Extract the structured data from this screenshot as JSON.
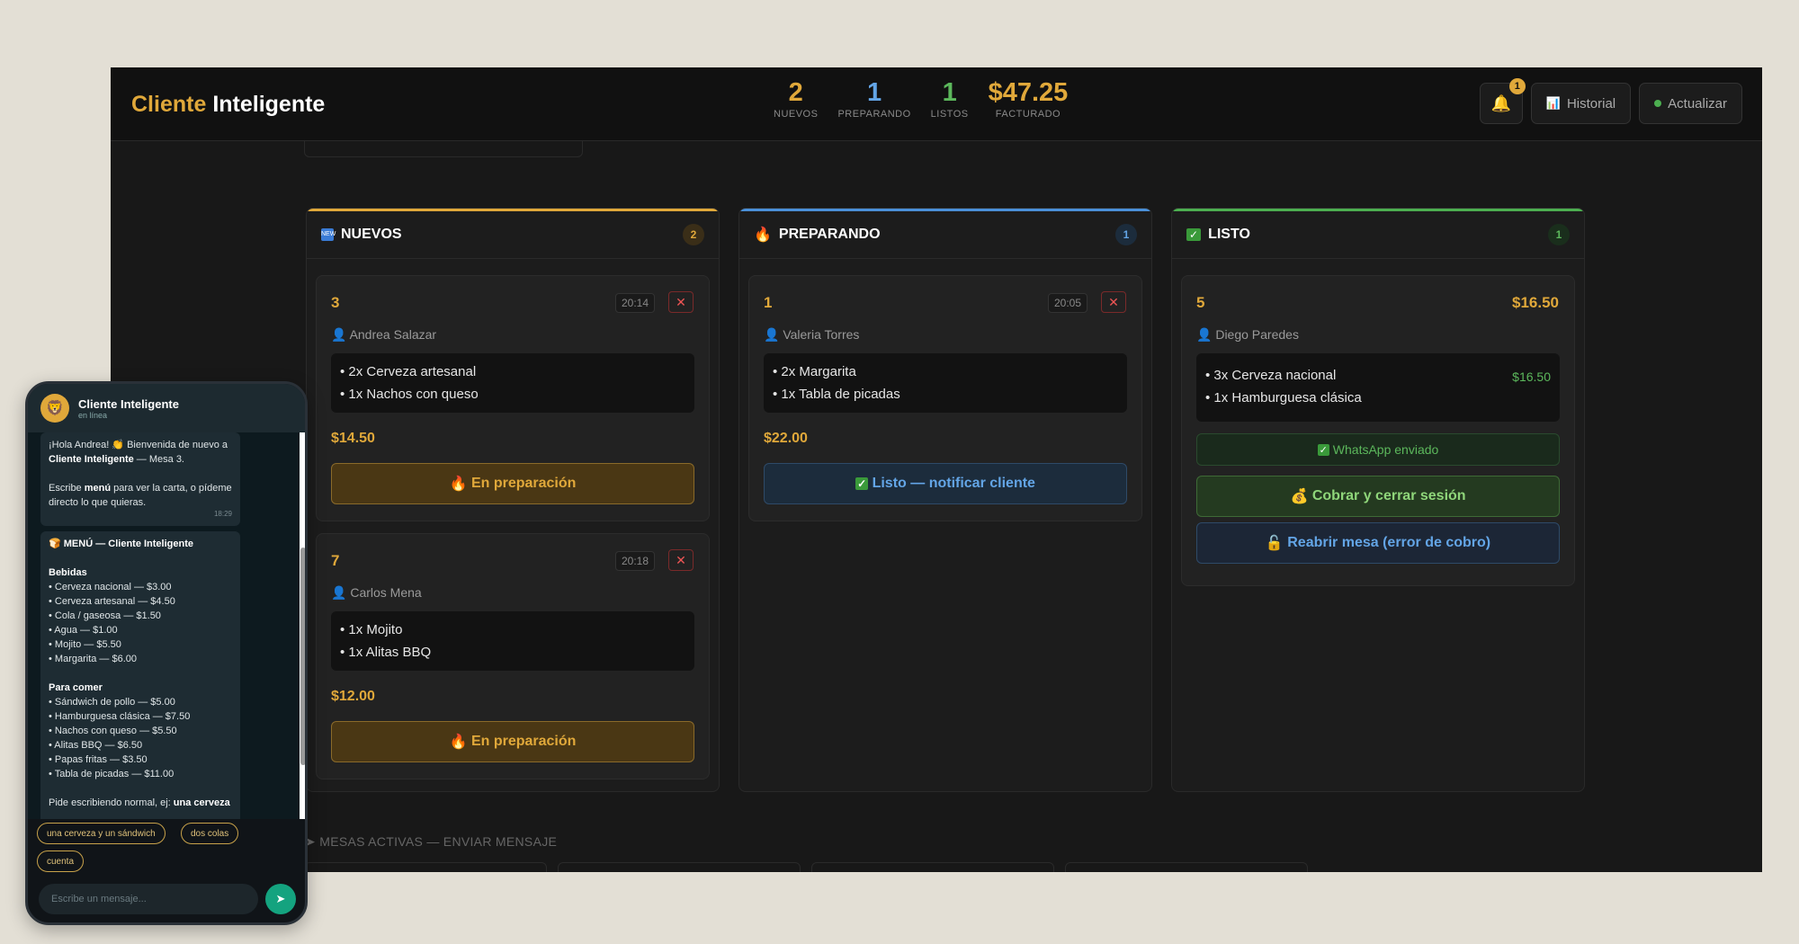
{
  "app": {
    "brand_accent": "Cliente",
    "brand_rest": "Inteligente"
  },
  "stats": [
    {
      "value": "2",
      "label": "NUEVOS",
      "color": "#e0a83a"
    },
    {
      "value": "1",
      "label": "PREPARANDO",
      "color": "#63a5e6"
    },
    {
      "value": "1",
      "label": "LISTOS",
      "color": "#5cb85c"
    },
    {
      "value": "$47.25",
      "label": "FACTURADO",
      "color": "#e0a83a"
    }
  ],
  "toolbar": {
    "notif_count": "1",
    "historial_label": "Historial",
    "actualizar_label": "Actualizar"
  },
  "columns": {
    "nuevos": {
      "title": "NUEVOS",
      "count": "2",
      "color": "#e0a83a"
    },
    "preparando": {
      "title": "PREPARANDO",
      "count": "1",
      "color": "#4a90d9"
    },
    "listo": {
      "title": "LISTO",
      "count": "1",
      "color": "#4caf50"
    }
  },
  "orders": {
    "o3": {
      "table": "3",
      "time": "20:14",
      "customer": "Andrea Salazar",
      "items": [
        "• 2x Cerveza artesanal",
        "• 1x Nachos con queso"
      ],
      "total": "$14.50",
      "action": "En preparación"
    },
    "o7": {
      "table": "7",
      "time": "20:18",
      "customer": "Carlos Mena",
      "items": [
        "• 1x Mojito",
        "• 1x Alitas BBQ"
      ],
      "total": "$12.00",
      "action": "En preparación"
    },
    "o1": {
      "table": "1",
      "time": "20:05",
      "customer": "Valeria Torres",
      "items": [
        "• 2x Margarita",
        "• 1x Tabla de picadas"
      ],
      "total": "$22.00",
      "action": "Listo — notificar cliente"
    },
    "o5": {
      "table": "5",
      "total": "$16.50",
      "customer": "Diego Paredes",
      "items": [
        "• 3x Cerveza nacional",
        "• 1x Hamburguesa clásica"
      ],
      "line_price": "$16.50",
      "whatsapp": "WhatsApp enviado",
      "pay": "Cobrar y cerrar sesión",
      "reopen": "Reabrir mesa (error de cobro)"
    }
  },
  "active_tables": {
    "label": "MESAS ACTIVAS — ENVIAR MENSAJE"
  },
  "phone": {
    "name": "Cliente Inteligente",
    "status": "en línea",
    "welcome_1": "¡Hola Andrea! 👏 Bienvenida de nuevo a",
    "welcome_brand": "Cliente Inteligente",
    "welcome_2": " — Mesa 3.",
    "welcome_3a": "Escribe ",
    "welcome_3b": "menú",
    "welcome_3c": " para ver la carta, o pídeme directo lo que quieras.",
    "welcome_time": "18:29",
    "menu_title": "MENÚ — Cliente Inteligente",
    "bebidas_title": "Bebidas",
    "bebidas": [
      "• Cerveza nacional — $3.00",
      "• Cerveza artesanal — $4.50",
      "• Cola / gaseosa — $1.50",
      "• Agua — $1.00",
      "• Mojito — $5.50",
      "• Margarita — $6.00"
    ],
    "comer_title": "Para comer",
    "comer": [
      "• Sándwich de pollo — $5.00",
      "• Hamburguesa clásica — $7.50",
      "• Nachos con queso — $5.50",
      "• Alitas BBQ — $6.50",
      "• Papas fritas — $3.50",
      "• Tabla de picadas — $11.00"
    ],
    "hint_a": "Pide escribiendo normal, ej: ",
    "hint_b": "una cerveza",
    "chips": [
      "una cerveza y un sándwich",
      "dos colas",
      "cuenta"
    ],
    "input_placeholder": "Escribe un mensaje..."
  }
}
